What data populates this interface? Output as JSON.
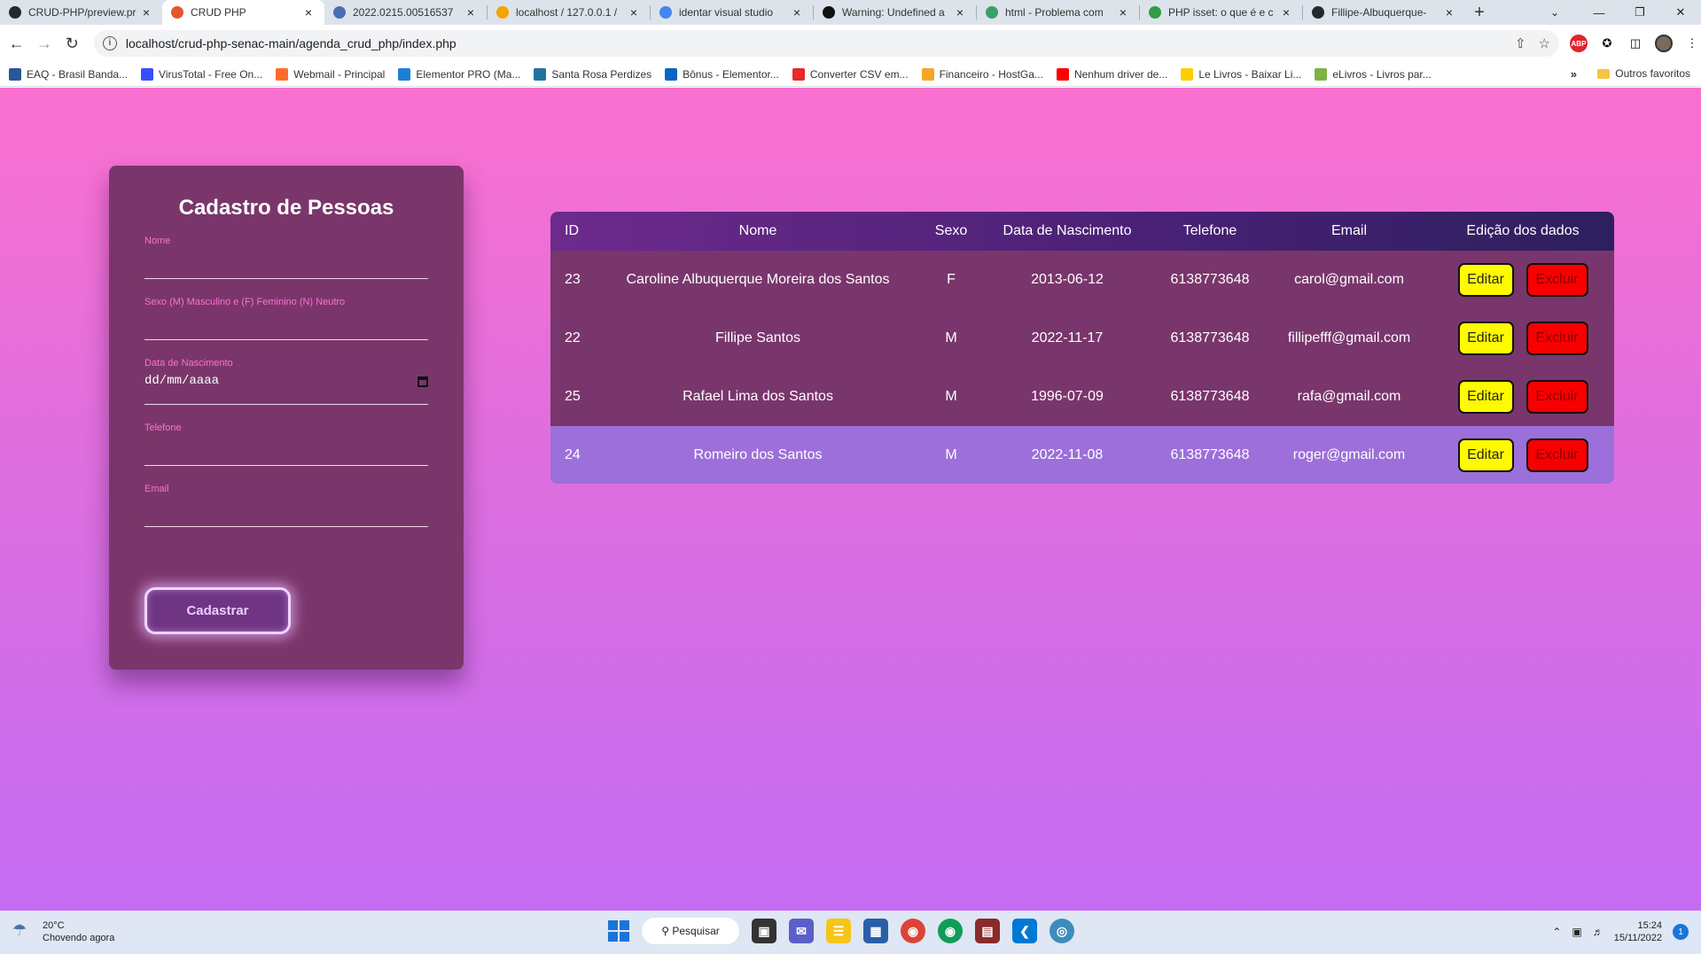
{
  "browser": {
    "tabs": [
      {
        "title": "CRUD-PHP/preview.pr",
        "icon": "github-icon",
        "color": "#24292e",
        "active": false
      },
      {
        "title": "CRUD PHP",
        "icon": "html-file-icon",
        "color": "#e4572e",
        "active": true
      },
      {
        "title": "2022.0215.00516537",
        "icon": "document-icon",
        "color": "#4a6fb5",
        "active": false
      },
      {
        "title": "localhost / 127.0.0.1 /",
        "icon": "phpmyadmin-icon",
        "color": "#f4a300",
        "active": false
      },
      {
        "title": "identar visual studio",
        "icon": "google-icon",
        "color": "#4285f4",
        "active": false
      },
      {
        "title": "Warning: Undefined a",
        "icon": "amazon-icon",
        "color": "#111111",
        "active": false
      },
      {
        "title": "html - Problema com",
        "icon": "stackoverflow-icon",
        "color": "#38a169",
        "active": false
      },
      {
        "title": "PHP isset: o que é e c",
        "icon": "arrow-icon",
        "color": "#2f9e44",
        "active": false
      },
      {
        "title": "Fillipe-Albuquerque-",
        "icon": "github-icon",
        "color": "#24292e",
        "active": false
      }
    ],
    "new_tab": "+",
    "url": "localhost/crud-php-senac-main/agenda_crud_php/index.php",
    "bookmarks": [
      {
        "label": "EAQ - Brasil Banda...",
        "color": "#2b5797"
      },
      {
        "label": "VirusTotal - Free On...",
        "color": "#394eff"
      },
      {
        "label": "Webmail - Principal",
        "color": "#ff6c2c"
      },
      {
        "label": "Elementor PRO (Ma...",
        "color": "#1c7fd6"
      },
      {
        "label": "Santa Rosa Perdizes",
        "color": "#21759b"
      },
      {
        "label": "Bônus - Elementor...",
        "color": "#0a66c2"
      },
      {
        "label": "Converter CSV em...",
        "color": "#e52b2b"
      },
      {
        "label": "Financeiro - HostGa...",
        "color": "#f5a623"
      },
      {
        "label": "Nenhum driver de...",
        "color": "#ff0000"
      },
      {
        "label": "Le Livros - Baixar Li...",
        "color": "#ffcc00"
      },
      {
        "label": "eLivros - Livros par...",
        "color": "#7cb342"
      }
    ],
    "bookmarks_more": "»",
    "other_bookmarks": "Outros favoritos"
  },
  "form": {
    "title": "Cadastro de Pessoas",
    "fields": [
      {
        "label": "Nome",
        "value": ""
      },
      {
        "label": "Sexo (M) Masculino e (F) Feminino (N) Neutro",
        "value": ""
      },
      {
        "label": "Data de Nascimento",
        "placeholder": "dd/mm/aaaa"
      },
      {
        "label": "Telefone",
        "value": ""
      },
      {
        "label": "Email",
        "value": ""
      }
    ],
    "submit_label": "Cadastrar"
  },
  "table": {
    "headers": [
      "ID",
      "Nome",
      "Sexo",
      "Data de Nascimento",
      "Telefone",
      "Email",
      "Edição dos dados"
    ],
    "rows": [
      {
        "id": "23",
        "nome": "Caroline Albuquerque Moreira dos Santos",
        "sexo": "F",
        "data": "2013-06-12",
        "telefone": "6138773648",
        "email": "carol@gmail.com"
      },
      {
        "id": "22",
        "nome": "Fillipe Santos",
        "sexo": "M",
        "data": "2022-11-17",
        "telefone": "6138773648",
        "email": "fillipefff@gmail.com"
      },
      {
        "id": "25",
        "nome": "Rafael Lima dos Santos",
        "sexo": "M",
        "data": "1996-07-09",
        "telefone": "6138773648",
        "email": "rafa@gmail.com"
      },
      {
        "id": "24",
        "nome": "Romeiro dos Santos",
        "sexo": "M",
        "data": "2022-11-08",
        "telefone": "6138773648",
        "email": "roger@gmail.com"
      }
    ],
    "edit_label": "Editar",
    "delete_label": "Excluir"
  },
  "taskbar": {
    "weather_temp": "20°C",
    "weather_desc": "Chovendo agora",
    "search_label": "Pesquisar",
    "time": "15:24",
    "date": "15/11/2022",
    "notifications": "1"
  }
}
